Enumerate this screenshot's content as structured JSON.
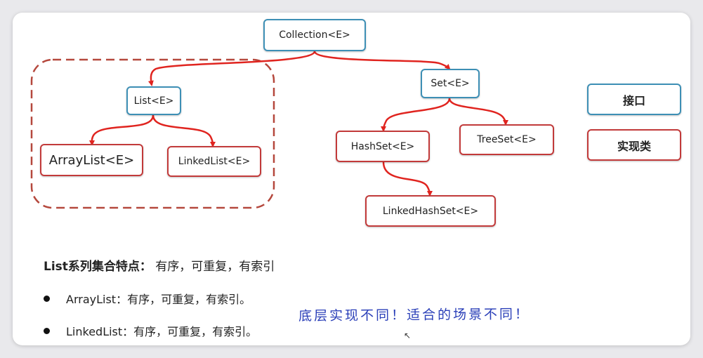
{
  "nodes": {
    "collection": "Collection<E>",
    "list": "List<E>",
    "set": "Set<E>",
    "arraylist": "ArrayList<E>",
    "linkedlist": "LinkedList<E>",
    "hashset": "HashSet<E>",
    "treeset": "TreeSet<E>",
    "linkedhashset": "LinkedHashSet<E>"
  },
  "legend": {
    "interface": "接口",
    "implementation": "实现类"
  },
  "text": {
    "heading_bold": "List系列集合特点：",
    "heading_rest": " 有序，可重复，有索引",
    "bullet1": "ArrayList：有序，可重复，有索引。",
    "bullet2": "LinkedList：有序，可重复，有索引。",
    "handwritten": "底层实现不同！适合的场景不同！"
  },
  "colors": {
    "interface_border": "#3d8fb5",
    "impl_border": "#c23a3a",
    "arrow": "#e0241f",
    "dashed_group": "#b5483d",
    "handwriting": "#2a3fb8"
  }
}
